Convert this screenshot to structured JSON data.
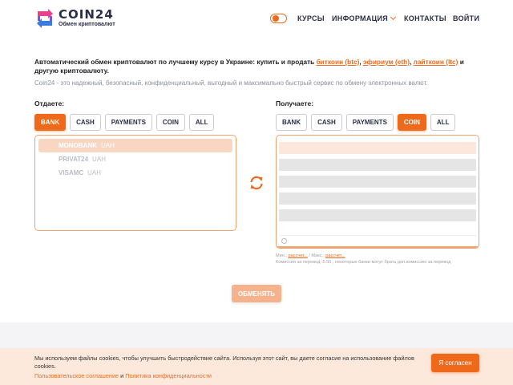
{
  "header": {
    "brand": "COIN24",
    "tagline": "Обмен криптовалют",
    "nav": {
      "rates": "КУРСЫ",
      "info": "ИНФОРМАЦИЯ",
      "contacts": "КОНТАКТЫ",
      "login": "ВОЙТИ"
    }
  },
  "intro": {
    "text_before": "Автоматический обмен криптовалют по лучшему курсу в Украине: купить и продать ",
    "link_btc": "биткоин (btc)",
    "sep1": ", ",
    "link_eth": "эфириум (eth)",
    "sep2": ", ",
    "link_ltc": "лайткоин (ltc)",
    "text_after": " и другую криптовалюту.",
    "description": "Coin24 - это надежный, безопасный, конфиденциальный, выгодный и максимально быстрый сервис по обмену электронных валют."
  },
  "give": {
    "label": "Отдаете:",
    "tabs": [
      "BANK",
      "CASH",
      "PAYMENTS",
      "COIN",
      "ALL"
    ],
    "active_tab": "BANK",
    "items": [
      {
        "name": "MONOBANK",
        "currency": "UAH"
      },
      {
        "name": "PRIVAT24",
        "currency": "UAH"
      },
      {
        "name": "VISAMC",
        "currency": "UAH"
      }
    ],
    "selected_index": 0
  },
  "get": {
    "label": "Получаете:",
    "tabs": [
      "BANK",
      "CASH",
      "PAYMENTS",
      "COIN",
      "ALL"
    ],
    "active_tab": "COIN",
    "limits": {
      "min_label": "Мин.: ",
      "min_value": "рассчет...",
      "max_label": " / Макс.: ",
      "max_value": "рассчет...",
      "commission": "Комиссия за перевод: 5.55 , некоторые банки могут брать доп.комиссию за перевод"
    }
  },
  "exchange_button": "ОБМЕНЯТЬ",
  "cookie": {
    "text": "Мы используем файлы cookies, чтобы улучшить быстродействие сайта. Используя этот сайт, вы даете согласие на использование файлов cookies.",
    "link_agreement": "Пользовательское соглашение",
    "and": " и ",
    "link_privacy": "Политика конфиденциальности",
    "accept": "Я согласен"
  },
  "colors": {
    "accent": "#ee6a1a",
    "accent_light": "#f6b28c",
    "selection": "#f9d6c2",
    "cookie_bg": "#fde9dc"
  }
}
